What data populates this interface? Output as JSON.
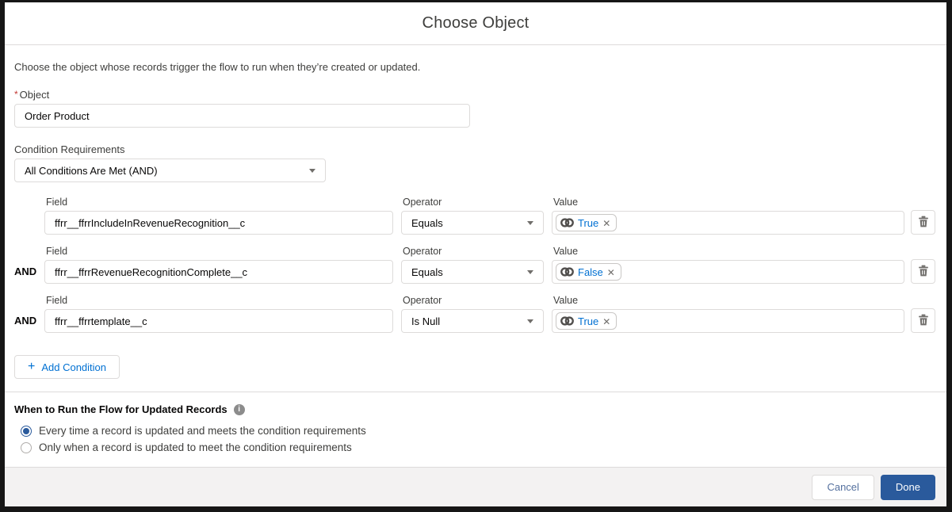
{
  "dialog": {
    "title": "Choose Object",
    "description": "Choose the object whose records trigger the flow to run when they’re created or updated."
  },
  "object_field": {
    "required_mark": "*",
    "label": "Object",
    "value": "Order Product"
  },
  "condition_requirements": {
    "label": "Condition Requirements",
    "value": "All Conditions Are Met (AND)"
  },
  "columns": {
    "field": "Field",
    "operator": "Operator",
    "value": "Value"
  },
  "conditions": [
    {
      "prefix": "",
      "field": "ffrr__ffrrIncludeInRevenueRecognition__c",
      "operator": "Equals",
      "value": "True",
      "remove_icon": "✕"
    },
    {
      "prefix": "AND",
      "field": "ffrr__ffrrRevenueRecognitionComplete__c",
      "operator": "Equals",
      "value": "False",
      "remove_icon": "✕"
    },
    {
      "prefix": "AND",
      "field": "ffrr__ffrrtemplate__c",
      "operator": "Is Null",
      "value": "True",
      "remove_icon": "✕"
    }
  ],
  "add_condition": {
    "icon": "+",
    "label": "Add Condition"
  },
  "when_to_run": {
    "heading": "When to Run the Flow for Updated Records",
    "info_icon": "i",
    "options": [
      {
        "label": "Every time a record is updated and meets the condition requirements",
        "selected": true
      },
      {
        "label": "Only when a record is updated to meet the condition requirements",
        "selected": false
      }
    ]
  },
  "footer": {
    "cancel_label": "Cancel",
    "done_label": "Done"
  },
  "icons": {
    "value_pill_icon": "overlapping-rings-icon",
    "delete_icon": "trash-icon",
    "operator_icon": "chevron-down-icon",
    "heading_icon": "info-icon"
  },
  "colors": {
    "accent_blue": "#0070d2",
    "done_button": "#2a5a9c",
    "border_gray": "#dddbda",
    "label_gray": "#3e3e3c",
    "footer_bg": "#f3f2f2",
    "required_red": "#c23934"
  }
}
